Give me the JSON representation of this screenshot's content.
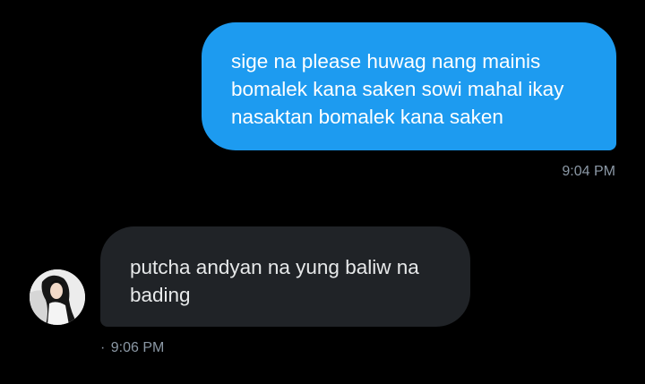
{
  "sent_message": {
    "lines": [
      "sige na please huwag nang mainis",
      "bomalek kana saken sowi mahal ikay",
      "nasaktan bomalek kana saken"
    ],
    "timestamp": "9:04 PM"
  },
  "received_message": {
    "lines": [
      "putcha andyan na yung baliw na",
      "bading"
    ],
    "status_mark": "·",
    "timestamp": "9:06 PM"
  },
  "colors": {
    "background": "#000000",
    "sent_bubble": "#1d9bf0",
    "received_bubble": "#202327",
    "timestamp": "#8b98a5"
  },
  "icons": {
    "avatar": "user-avatar-photo"
  }
}
